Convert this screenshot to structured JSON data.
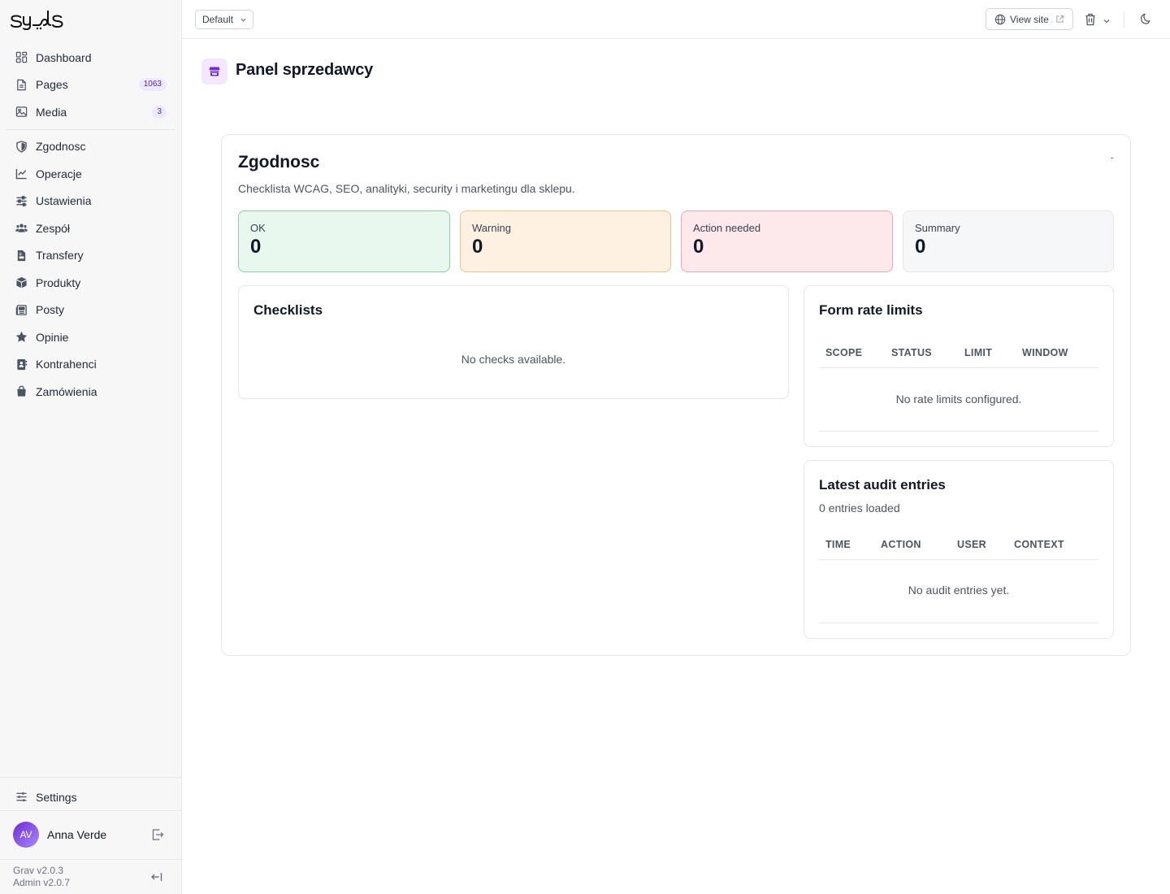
{
  "brand": {
    "logo_text": "syls"
  },
  "sidebar": {
    "items": [
      {
        "label": "Dashboard",
        "icon": "dashboard-icon"
      },
      {
        "label": "Pages",
        "icon": "file-icon",
        "badge": "1063"
      },
      {
        "label": "Media",
        "icon": "image-icon",
        "badge": "3"
      }
    ],
    "plugin_items": [
      {
        "label": "Zgodnosc",
        "icon": "shield-icon"
      },
      {
        "label": "Operacje",
        "icon": "chart-line-icon"
      },
      {
        "label": "Ustawienia",
        "icon": "sliders-icon"
      },
      {
        "label": "Zespół",
        "icon": "users-icon"
      },
      {
        "label": "Transfery",
        "icon": "file-invoice-icon"
      },
      {
        "label": "Produkty",
        "icon": "box-icon"
      },
      {
        "label": "Posty",
        "icon": "newspaper-icon"
      },
      {
        "label": "Opinie",
        "icon": "star-icon"
      },
      {
        "label": "Kontrahenci",
        "icon": "address-book-icon"
      },
      {
        "label": "Zamówienia",
        "icon": "shopping-bag-icon"
      }
    ],
    "settings_label": "Settings",
    "user": {
      "initials": "AV",
      "name": "Anna Verde"
    },
    "versions": {
      "grav": "Grav v2.0.3",
      "admin": "Admin v2.0.7"
    }
  },
  "topbar": {
    "environment": "Default",
    "view_site": "View site"
  },
  "page": {
    "title": "Panel sprzedawcy"
  },
  "card": {
    "title": "Zgodnosc",
    "subtitle": "Checklista WCAG, SEO, analityki, security i marketingu dla sklepu.",
    "collapse_label": "-",
    "stats": [
      {
        "label": "OK",
        "value": "0"
      },
      {
        "label": "Warning",
        "value": "0"
      },
      {
        "label": "Action needed",
        "value": "0"
      },
      {
        "label": "Summary",
        "value": "0"
      }
    ],
    "checklists": {
      "title": "Checklists",
      "empty": "No checks available."
    },
    "rate_limits": {
      "title": "Form rate limits",
      "columns": [
        "SCOPE",
        "STATUS",
        "LIMIT",
        "WINDOW"
      ],
      "empty": "No rate limits configured."
    },
    "audit": {
      "title": "Latest audit entries",
      "subtitle": "0 entries loaded",
      "columns": [
        "TIME",
        "ACTION",
        "USER",
        "CONTEXT"
      ],
      "empty": "No audit entries yet."
    }
  },
  "colors": {
    "accent": "#6d28d9",
    "ok_bg": "#e9f8ee",
    "warning_bg": "#fef1e1",
    "action_bg": "#fde8ec",
    "summary_bg": "#f6f7f9"
  }
}
